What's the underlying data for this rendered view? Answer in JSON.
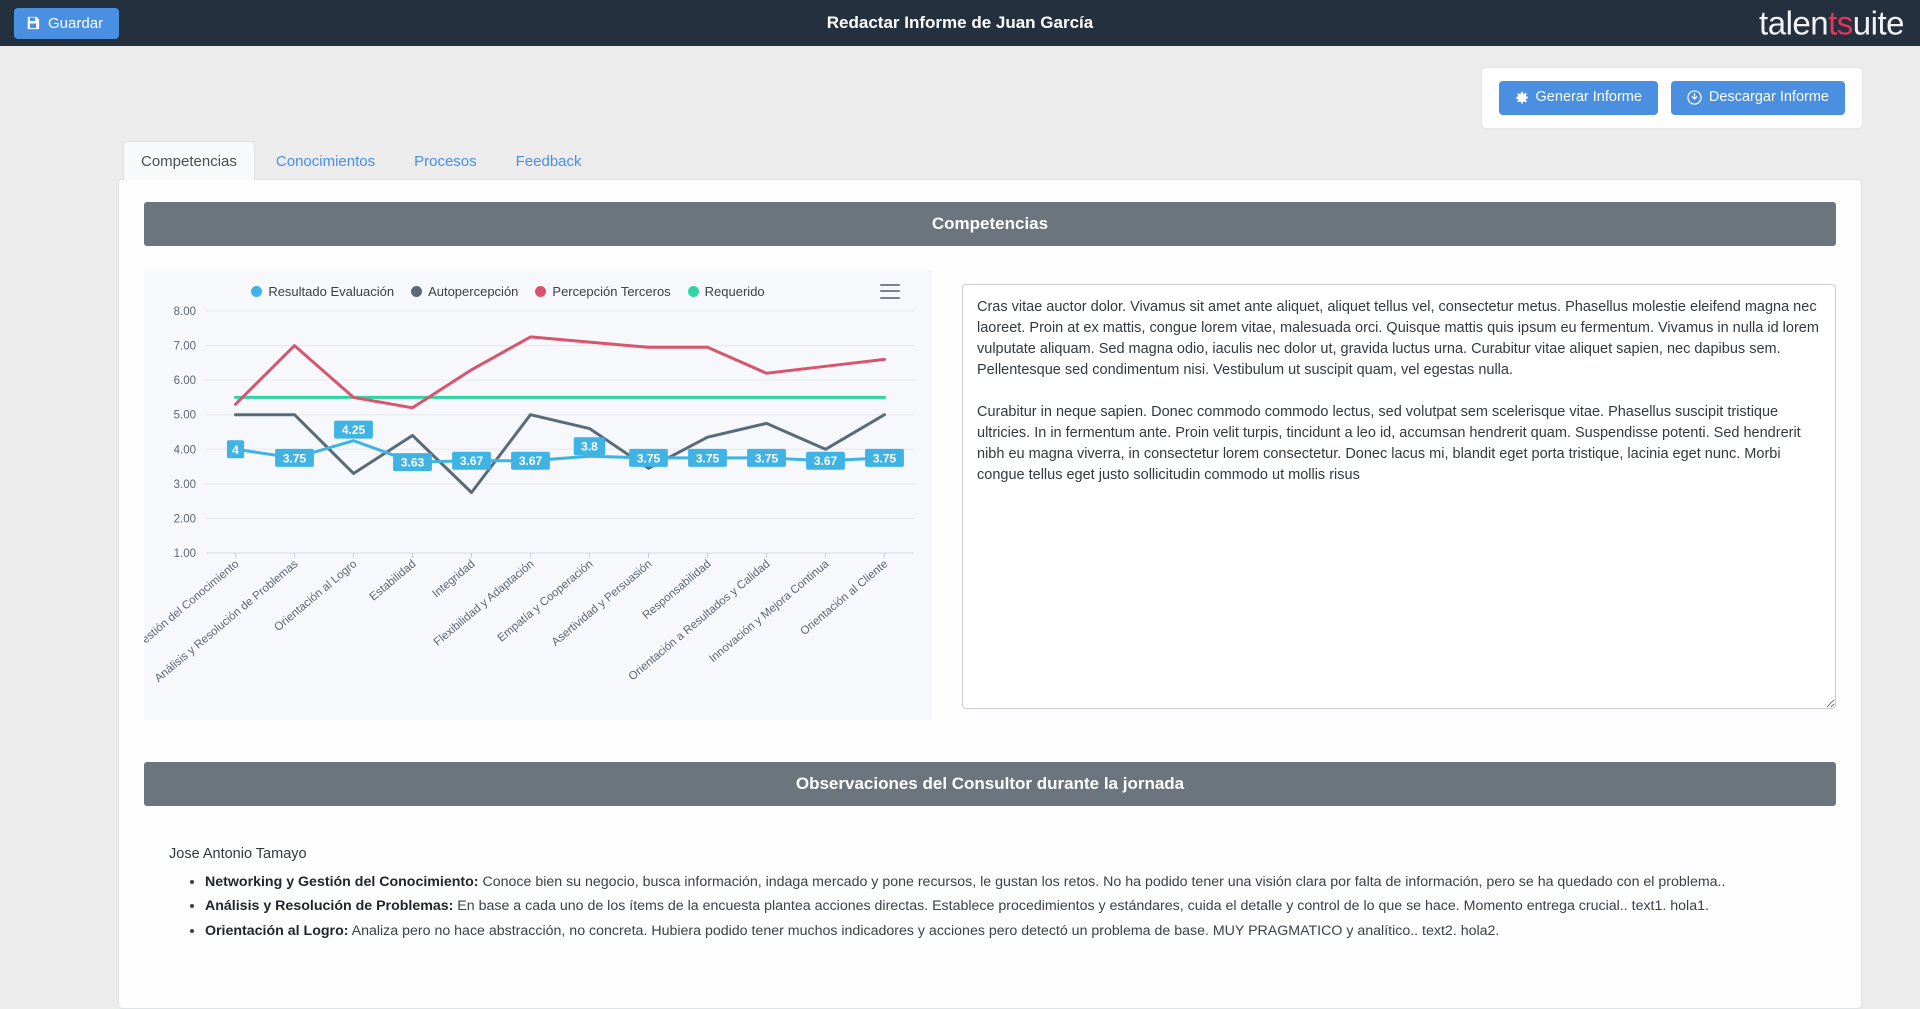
{
  "topbar": {
    "save_label": "Guardar",
    "save_icon": "save-floppy-icon",
    "title": "Redactar Informe de Juan García",
    "logo_part1": "talen",
    "logo_accent": "ts",
    "logo_part2": "uite"
  },
  "actions": {
    "generate_label": "Generar Informe",
    "generate_icon": "gear-icon",
    "download_label": "Descargar Informe",
    "download_icon": "download-circle-icon"
  },
  "tabs": [
    {
      "label": "Competencias",
      "active": true
    },
    {
      "label": "Conocimientos",
      "active": false
    },
    {
      "label": "Procesos",
      "active": false
    },
    {
      "label": "Feedback",
      "active": false
    }
  ],
  "sections": {
    "competencias_header": "Competencias",
    "observaciones_header": "Observaciones del Consultor durante la jornada"
  },
  "notes": {
    "value": "Cras vitae auctor dolor. Vivamus sit amet ante aliquet, aliquet tellus vel, consectetur metus. Phasellus molestie eleifend magna nec laoreet. Proin at ex mattis, congue lorem vitae, malesuada orci. Quisque mattis quis ipsum eu fermentum. Vivamus in nulla id lorem vulputate aliquam. Sed magna odio, iaculis nec dolor ut, gravida luctus urna. Curabitur vitae aliquet sapien, nec dapibus sem. Pellentesque sed condimentum nisi. Vestibulum ut suscipit quam, vel egestas nulla.\n\nCurabitur in neque sapien. Donec commodo commodo lectus, sed volutpat sem scelerisque vitae. Phasellus suscipit tristique ultricies. In in fermentum ante. Proin velit turpis, tincidunt a leo id, accumsan hendrerit quam. Suspendisse potenti. Sed hendrerit nibh eu magna viverra, in consectetur lorem consectetur. Donec lacus mi, blandit eget porta tristique, lacinia eget nunc. Morbi congue tellus eget justo sollicitudin commodo ut mollis risus",
    "placeholder": ""
  },
  "observations": {
    "consultant": "Jose Antonio Tamayo",
    "items": [
      {
        "title": "Networking y Gestión del Conocimiento:",
        "text": " Conoce bien su negocio, busca información, indaga mercado y pone recursos, le gustan los retos. No ha podido tener una visión clara por falta de información, pero se ha quedado con el problema.."
      },
      {
        "title": "Análisis y Resolución de Problemas:",
        "text": " En base a cada uno de los ítems de la encuesta plantea acciones directas. Establece procedimientos y estándares, cuida el detalle y control de lo que se hace. Momento entrega crucial.. text1. hola1."
      },
      {
        "title": "Orientación al Logro:",
        "text": " Analiza pero no hace abstracción, no concreta. Hubiera podido tener muchos indicadores y acciones pero detectó un problema de base. MUY PRAGMATICO y analítico.. text2. hola2."
      }
    ]
  },
  "chart_data": {
    "type": "line",
    "title": "",
    "xlabel": "",
    "ylabel": "",
    "ylim": [
      1,
      8
    ],
    "yticks": [
      "1.00",
      "2.00",
      "3.00",
      "4.00",
      "5.00",
      "6.00",
      "7.00",
      "8.00"
    ],
    "grid": true,
    "legend_position": "top-center",
    "menu_icon": "hamburger-menu-icon",
    "categories": [
      "Networking y Gestión del Conocimiento",
      "Análisis y Resolución de Problemas",
      "Orientación al Logro",
      "Estabilidad",
      "Integridad",
      "Flexibilidad y Adaptación",
      "Empatía y Cooperación",
      "Asertividad y Persuasión",
      "Responsabilidad",
      "Orientación a Resultados y Calidad",
      "Innovación y Mejora Continua",
      "Orientación al Cliente"
    ],
    "series": [
      {
        "name": "Resultado Evaluación",
        "color": "#3fb3e4",
        "show_labels": true,
        "values": [
          4,
          3.75,
          4.25,
          3.63,
          3.67,
          3.67,
          3.8,
          3.75,
          3.75,
          3.75,
          3.67,
          3.75
        ],
        "labels": [
          "4",
          "3.75",
          "4.25",
          "3.63",
          "3.67",
          "3.67",
          "3.8",
          "3.75",
          "3.75",
          "3.75",
          "3.67",
          "3.75"
        ]
      },
      {
        "name": "Autopercepción",
        "color": "#5a6b78",
        "show_labels": false,
        "values": [
          5.0,
          5.0,
          3.3,
          4.4,
          2.75,
          5.0,
          4.6,
          3.45,
          4.35,
          4.75,
          4.0,
          5.0
        ]
      },
      {
        "name": "Percepción Terceros",
        "color": "#d9556e",
        "show_labels": false,
        "values": [
          5.3,
          7.0,
          5.5,
          5.2,
          6.3,
          7.25,
          7.1,
          6.95,
          6.95,
          6.2,
          6.4,
          6.6
        ]
      },
      {
        "name": "Requerido",
        "color": "#2fd4a0",
        "show_labels": false,
        "values": [
          5.5,
          5.5,
          5.5,
          5.5,
          5.5,
          5.5,
          5.5,
          5.5,
          5.5,
          5.5,
          5.5,
          5.5
        ]
      }
    ]
  }
}
